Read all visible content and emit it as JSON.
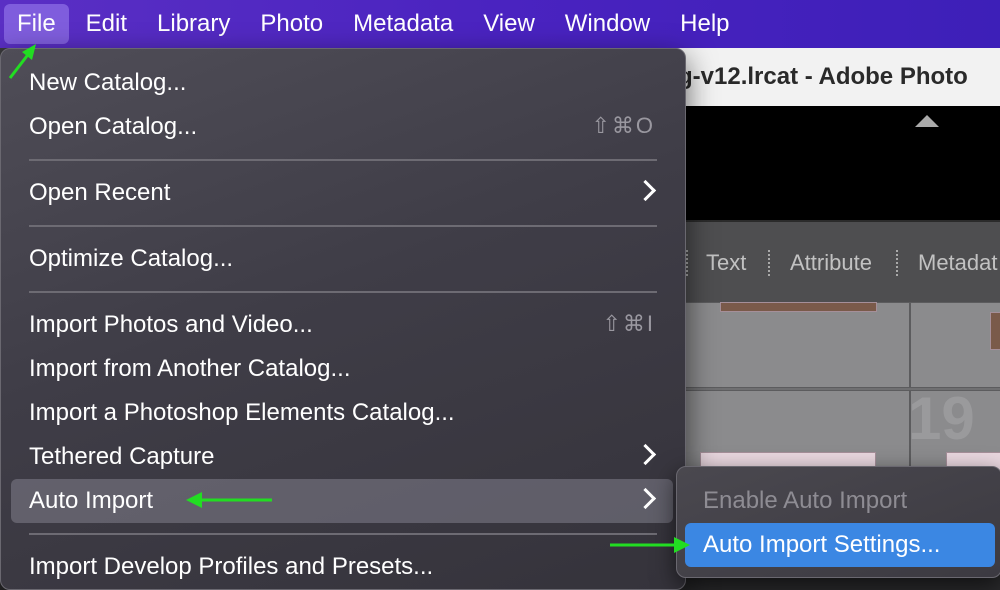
{
  "menubar": {
    "items": [
      "File",
      "Edit",
      "Library",
      "Photo",
      "Metadata",
      "View",
      "Window",
      "Help"
    ]
  },
  "window": {
    "title": "g-v12.lrcat - Adobe Photo"
  },
  "filter_bar": {
    "items": [
      "Text",
      "Attribute",
      "Metadat"
    ]
  },
  "grid": {
    "partial_number": "19"
  },
  "file_menu": {
    "new_catalog": "New Catalog...",
    "open_catalog": "Open Catalog...",
    "open_catalog_shortcut": "⇧⌘O",
    "open_recent": "Open Recent",
    "optimize_catalog": "Optimize Catalog...",
    "import_photos": "Import Photos and Video...",
    "import_photos_shortcut": "⇧⌘I",
    "import_catalog": "Import from Another Catalog...",
    "import_elements": "Import a Photoshop Elements Catalog...",
    "tethered_capture": "Tethered Capture",
    "auto_import": "Auto Import",
    "import_develop": "Import Develop Profiles and Presets..."
  },
  "auto_import_submenu": {
    "enable": "Enable Auto Import",
    "settings": "Auto Import Settings..."
  },
  "colors": {
    "menubar": "#4a23c0",
    "selection": "#3b87e3",
    "annotation_arrow": "#22dd22"
  }
}
